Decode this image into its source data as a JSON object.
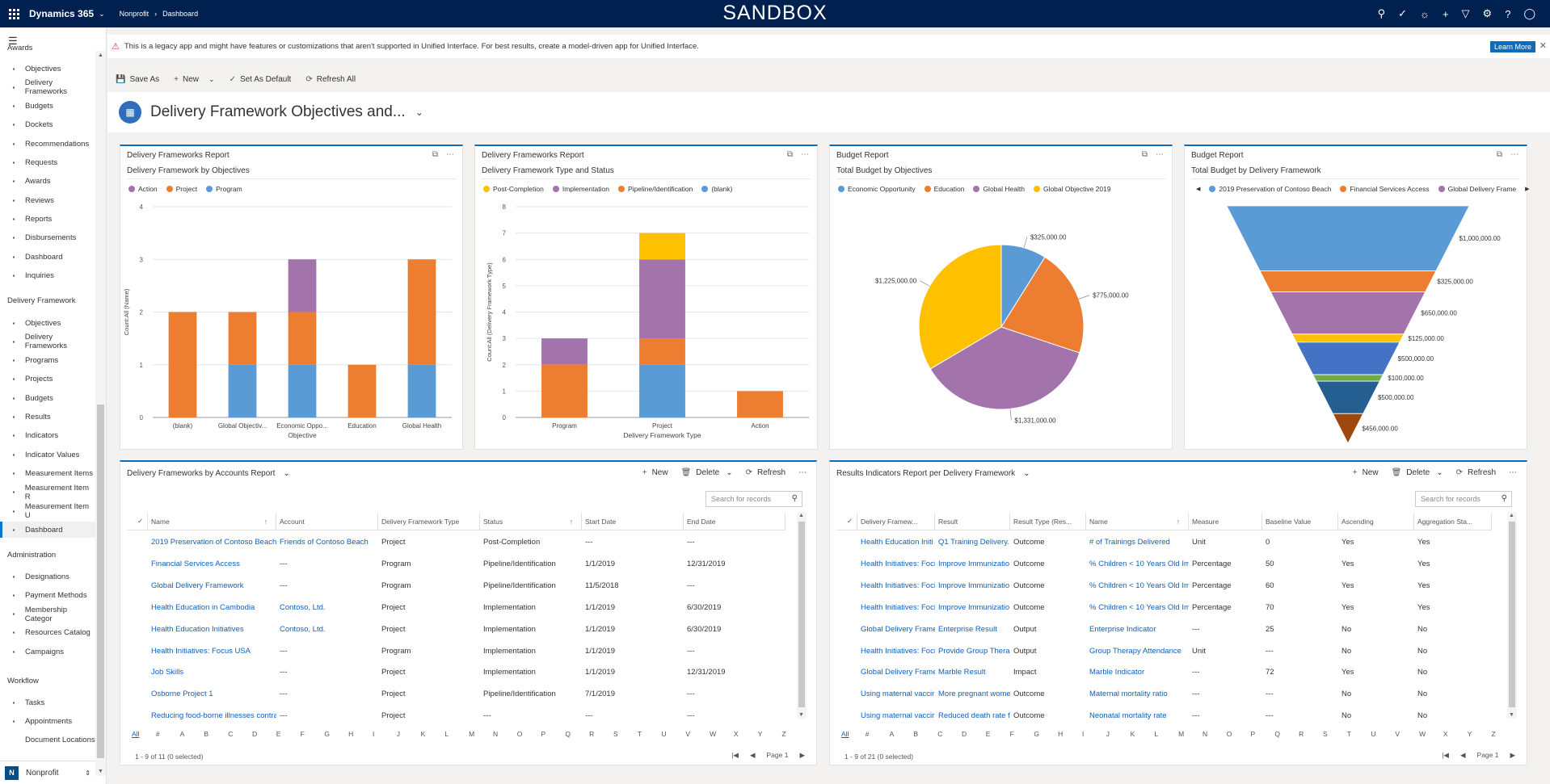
{
  "topbar": {
    "app_name": "Dynamics 365",
    "area": "Nonprofit",
    "crumb": "Dashboard",
    "banner_title": "SANDBOX",
    "icons": [
      "search-icon",
      "task-icon",
      "lightbulb-icon",
      "plus-icon",
      "filter-icon",
      "gear-icon",
      "help-icon",
      "user-icon"
    ]
  },
  "sidebar": {
    "cut_section": "Awards",
    "group1": [
      {
        "label": "Objectives",
        "icon": "objectives-icon"
      },
      {
        "label": "Delivery Frameworks",
        "icon": "delivery-framework-icon"
      },
      {
        "label": "Budgets",
        "icon": "budget-icon"
      },
      {
        "label": "Dockets",
        "icon": "docket-icon"
      },
      {
        "label": "Recommendations",
        "icon": "recommendation-icon"
      },
      {
        "label": "Requests",
        "icon": "request-icon"
      },
      {
        "label": "Awards",
        "icon": "award-icon"
      },
      {
        "label": "Reviews",
        "icon": "review-icon"
      },
      {
        "label": "Reports",
        "icon": "report-icon"
      },
      {
        "label": "Disbursements",
        "icon": "disbursement-icon"
      },
      {
        "label": "Dashboard",
        "icon": "dashboard-icon"
      },
      {
        "label": "Inquiries",
        "icon": "inquiry-icon"
      }
    ],
    "section2": "Delivery Framework",
    "group2": [
      {
        "label": "Objectives",
        "icon": "objectives-icon"
      },
      {
        "label": "Delivery Frameworks",
        "icon": "delivery-framework-icon"
      },
      {
        "label": "Programs",
        "icon": "program-icon"
      },
      {
        "label": "Projects",
        "icon": "project-icon"
      },
      {
        "label": "Budgets",
        "icon": "budget-icon"
      },
      {
        "label": "Results",
        "icon": "result-icon"
      },
      {
        "label": "Indicators",
        "icon": "indicator-icon"
      },
      {
        "label": "Indicator Values",
        "icon": "indicator-value-icon"
      },
      {
        "label": "Measurement Items",
        "icon": "measurement-icon"
      },
      {
        "label": "Measurement Item R",
        "icon": "measurement-icon"
      },
      {
        "label": "Measurement Item U",
        "icon": "measurement-icon"
      },
      {
        "label": "Dashboard",
        "icon": "dashboard-icon"
      }
    ],
    "section3": "Administration",
    "group3": [
      {
        "label": "Designations",
        "icon": "designation-icon"
      },
      {
        "label": "Payment Methods",
        "icon": "payment-icon"
      },
      {
        "label": "Membership Categor",
        "icon": "membership-icon"
      },
      {
        "label": "Resources Catalog",
        "icon": "catalog-icon"
      },
      {
        "label": "Campaigns",
        "icon": "campaign-icon"
      }
    ],
    "section4": "Workflow",
    "group4": [
      {
        "label": "Tasks",
        "icon": "task-icon"
      },
      {
        "label": "Appointments",
        "icon": "appointment-icon"
      },
      {
        "label": "Document Locations",
        "icon": ""
      }
    ],
    "footer_avatar": "N",
    "footer_area": "Nonprofit"
  },
  "banner": {
    "message": "This is a legacy app and might have features or customizations that aren't supported in Unified Interface. For best results, create a model-driven app for Unified Interface.",
    "learn_more": "Learn More"
  },
  "commands": {
    "save_as": "Save As",
    "new": "New",
    "set_default": "Set As Default",
    "refresh_all": "Refresh All"
  },
  "dashboard_title": "Delivery Framework Objectives and...",
  "cards": {
    "c1": {
      "header": "Delivery Frameworks Report",
      "sub": "Delivery Framework by Objectives"
    },
    "c2": {
      "header": "Delivery Frameworks Report",
      "sub": "Delivery Framework Type and Status"
    },
    "c3": {
      "header": "Budget Report",
      "sub": "Total Budget by Objectives"
    },
    "c4": {
      "header": "Budget Report",
      "sub": "Total Budget by Delivery Framework"
    }
  },
  "colors": {
    "blue": "#5b9bd5",
    "orange": "#ed7d31",
    "purple": "#a374ac",
    "yellow": "#ffc000",
    "gray": "#a5a5a5",
    "darkblue": "#2e5fa1",
    "green": "#70ad47",
    "darkorange": "#a0440f",
    "brand": "#002050",
    "accent": "#0f6cbd"
  },
  "chart_data": [
    {
      "type": "bar",
      "stacked": true,
      "title": "Delivery Framework by Objectives",
      "xlabel": "Objective",
      "ylabel": "Count:All (Name)",
      "ylim": [
        0,
        4
      ],
      "yticks": [
        0,
        1,
        2,
        3,
        4
      ],
      "categories": [
        "(blank)",
        "Global Objectiv...",
        "Economic Oppo...",
        "Education",
        "Global Health"
      ],
      "series": [
        {
          "name": "Program",
          "color": "#5b9bd5",
          "values": [
            0,
            1,
            1,
            0,
            1
          ]
        },
        {
          "name": "Project",
          "color": "#ed7d31",
          "values": [
            2,
            1,
            1,
            1,
            2
          ]
        },
        {
          "name": "Action",
          "color": "#a374ac",
          "values": [
            0,
            0,
            1,
            0,
            0
          ]
        }
      ],
      "legend": [
        "Action",
        "Project",
        "Program"
      ]
    },
    {
      "type": "bar",
      "stacked": true,
      "title": "Delivery Framework Type and Status",
      "xlabel": "Delivery Framework Type",
      "ylabel": "Count:All (Delivery Framework Type)",
      "ylim": [
        0,
        8
      ],
      "yticks": [
        0,
        1,
        2,
        3,
        4,
        5,
        6,
        7,
        8
      ],
      "categories": [
        "Program",
        "Project",
        "Action"
      ],
      "series": [
        {
          "name": "(blank)",
          "color": "#5b9bd5",
          "values": [
            0,
            2,
            0
          ]
        },
        {
          "name": "Pipeline/Identification",
          "color": "#ed7d31",
          "values": [
            2,
            1,
            1
          ]
        },
        {
          "name": "Implementation",
          "color": "#a374ac",
          "values": [
            1,
            3,
            0
          ]
        },
        {
          "name": "Post-Completion",
          "color": "#ffc000",
          "values": [
            0,
            1,
            0
          ]
        }
      ],
      "legend": [
        "Post-Completion",
        "Implementation",
        "Pipeline/Identification",
        "(blank)"
      ]
    },
    {
      "type": "pie",
      "title": "Total Budget by Objectives",
      "slices": [
        {
          "name": "Economic Opportunity",
          "color": "#5b9bd5",
          "value": 325000,
          "label": "$325,000.00"
        },
        {
          "name": "Education",
          "color": "#ed7d31",
          "value": 775000,
          "label": "$775,000.00"
        },
        {
          "name": "Global Health",
          "color": "#a374ac",
          "value": 1331000,
          "label": "$1,331,000.00"
        },
        {
          "name": "Global Objective 2019",
          "color": "#ffc000",
          "value": 1225000,
          "label": "$1,225,000.00"
        }
      ],
      "legend": [
        "Economic Opportunity",
        "Education",
        "Global Health",
        "Global Objective 2019"
      ]
    },
    {
      "type": "funnel",
      "title": "Total Budget by Delivery Framework",
      "legend": [
        "2019 Preservation of Contoso Beach",
        "Financial Services Access",
        "Global Delivery Frame"
      ],
      "legend_colors": [
        "#5b9bd5",
        "#ed7d31",
        "#a374ac"
      ],
      "stages": [
        {
          "value": 1000000,
          "label": "$1,000,000.00",
          "color": "#5b9bd5"
        },
        {
          "value": 325000,
          "label": "$325,000.00",
          "color": "#ed7d31"
        },
        {
          "value": 650000,
          "label": "$650,000.00",
          "color": "#a374ac"
        },
        {
          "value": 125000,
          "label": "$125,000.00",
          "color": "#ffc000"
        },
        {
          "value": 500000,
          "label": "$500,000.00",
          "color": "#4472c4"
        },
        {
          "value": 100000,
          "label": "$100,000.00",
          "color": "#70ad47"
        },
        {
          "value": 500000,
          "label": "$500,000.00",
          "color": "#255e91"
        },
        {
          "value": 456000,
          "label": "$456,000.00",
          "color": "#9e480e"
        }
      ]
    }
  ],
  "grid1": {
    "title": "Delivery Frameworks by Accounts Report",
    "new_label": "New",
    "delete_label": "Delete",
    "refresh_label": "Refresh",
    "search_placeholder": "Search for records",
    "columns": [
      "Name",
      "Account",
      "Delivery Framework Type",
      "Status",
      "Start Date",
      "End Date"
    ],
    "rows": [
      [
        "2019 Preservation of Contoso Beach...",
        "Friends of Contoso Beach",
        "Project",
        "Post-Completion",
        "---",
        "---"
      ],
      [
        "Financial Services Access",
        "---",
        "Program",
        "Pipeline/Identification",
        "1/1/2019",
        "12/31/2019"
      ],
      [
        "Global Delivery Framework",
        "---",
        "Program",
        "Pipeline/Identification",
        "11/5/2018",
        "---"
      ],
      [
        "Health Education in Cambodia",
        "Contoso, Ltd.",
        "Project",
        "Implementation",
        "1/1/2019",
        "6/30/2019"
      ],
      [
        "Health Education Initiatives",
        "Contoso, Ltd.",
        "Project",
        "Implementation",
        "1/1/2019",
        "6/30/2019"
      ],
      [
        "Health Initiatives: Focus USA",
        "---",
        "Program",
        "Implementation",
        "1/1/2019",
        "---"
      ],
      [
        "Job Skills",
        "---",
        "Project",
        "Implementation",
        "1/1/2019",
        "12/31/2019"
      ],
      [
        "Osborne Project 1",
        "---",
        "Project",
        "Pipeline/Identification",
        "7/1/2019",
        "---"
      ],
      [
        "Reducing food-borne illnesses contra",
        "---",
        "Project",
        "---",
        "---",
        "---"
      ]
    ],
    "footer": "1 - 9 of 11 (0 selected)",
    "page": "Page 1"
  },
  "grid2": {
    "title": "Results Indicators Report per Delivery Framework",
    "new_label": "New",
    "delete_label": "Delete",
    "refresh_label": "Refresh",
    "search_placeholder": "Search for records",
    "columns": [
      "Delivery Framew...",
      "Result",
      "Result Type (Res...",
      "Name",
      "Measure",
      "Baseline Value",
      "Ascending",
      "Aggregation Sta..."
    ],
    "rows": [
      [
        "Health Education Initi",
        "Q1 Training Delivery...",
        "Outcome",
        "# of Trainings Delivered",
        "Unit",
        "0",
        "Yes",
        "Yes"
      ],
      [
        "Health Initiatives: Foci",
        "Improve Immunizatio",
        "Outcome",
        "% Children < 10 Years Old Imr",
        "Percentage",
        "50",
        "Yes",
        "Yes"
      ],
      [
        "Health Initiatives: Foci",
        "Improve Immunizatio",
        "Outcome",
        "% Children < 10 Years Old Imr",
        "Percentage",
        "60",
        "Yes",
        "Yes"
      ],
      [
        "Health Initiatives: Foci",
        "Improve Immunizatio",
        "Outcome",
        "% Children < 10 Years Old Imr",
        "Percentage",
        "70",
        "Yes",
        "Yes"
      ],
      [
        "Global Delivery Frame",
        "Enterprise Result",
        "Output",
        "Enterprise Indicator",
        "---",
        "25",
        "No",
        "No"
      ],
      [
        "Health Initiatives: Foci",
        "Provide Group Therap",
        "Output",
        "Group Therapy Attendance",
        "Unit",
        "---",
        "No",
        "No"
      ],
      [
        "Global Delivery Frame",
        "Marble Result",
        "Impact",
        "Marble Indicator",
        "---",
        "72",
        "Yes",
        "No"
      ],
      [
        "Using maternal vaccir",
        "More pregnant wome",
        "Outcome",
        "Maternal mortality ratio",
        "---",
        "---",
        "No",
        "No"
      ],
      [
        "Using maternal vaccir",
        "Reduced death rate fr",
        "Outcome",
        "Neonatal mortality rate",
        "---",
        "---",
        "No",
        "No"
      ]
    ],
    "footer": "1 - 9 of 21 (0 selected)",
    "page": "Page 1"
  },
  "alphabet": [
    "All",
    "#",
    "A",
    "B",
    "C",
    "D",
    "E",
    "F",
    "G",
    "H",
    "I",
    "J",
    "K",
    "L",
    "M",
    "N",
    "O",
    "P",
    "Q",
    "R",
    "S",
    "T",
    "U",
    "V",
    "W",
    "X",
    "Y",
    "Z"
  ]
}
